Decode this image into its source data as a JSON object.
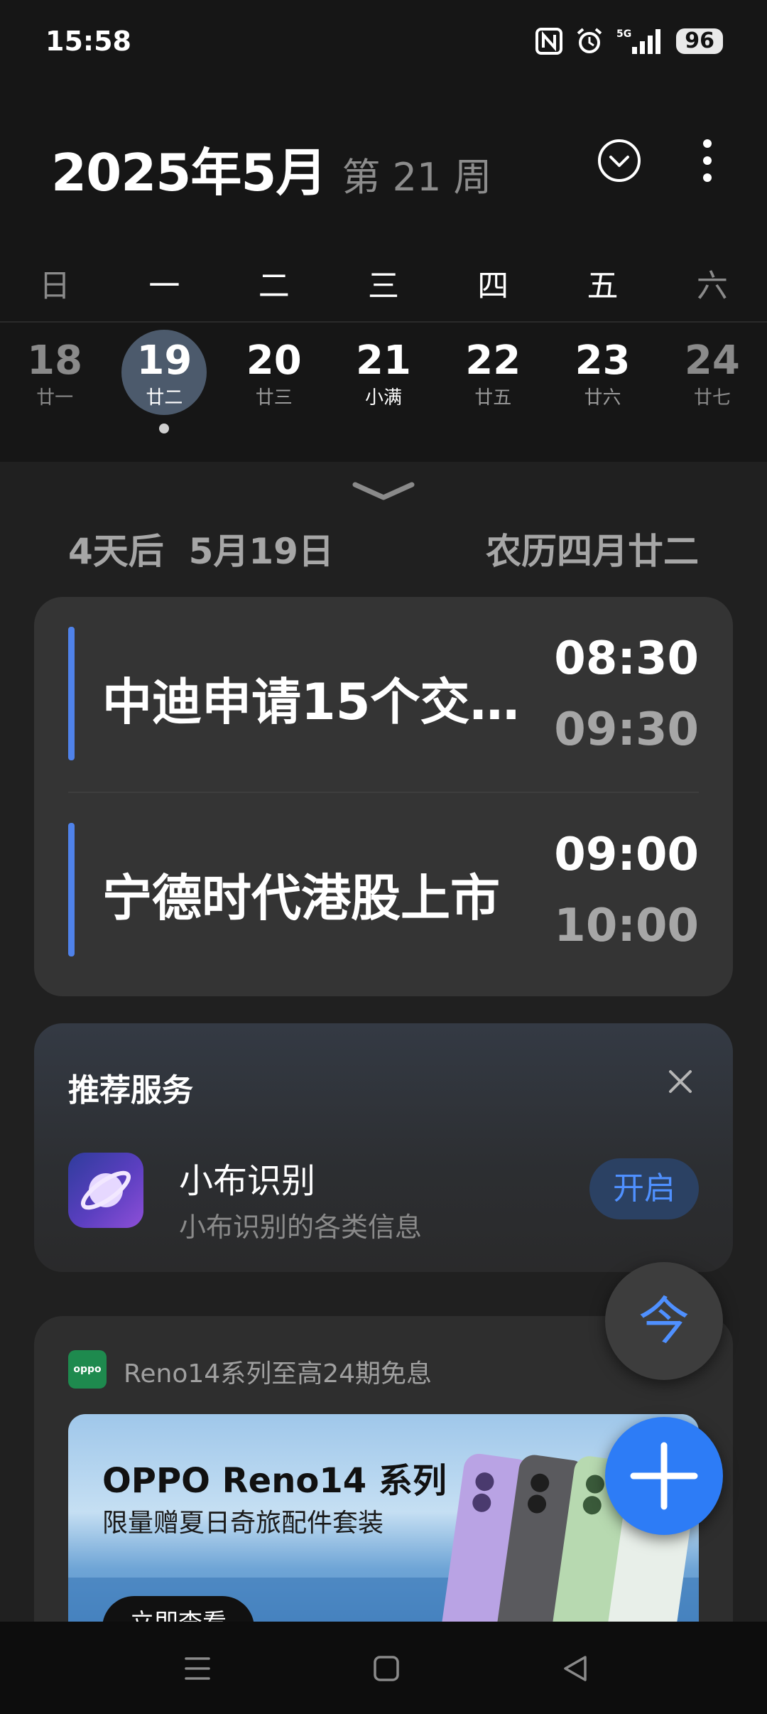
{
  "status_bar": {
    "time": "15:58",
    "network": "5G",
    "battery": "96",
    "icons": [
      "nfc-icon",
      "alarm-icon",
      "signal-icon",
      "battery-icon"
    ]
  },
  "header": {
    "month_title": "2025年5月",
    "week_label": "第 21 周",
    "buttons": [
      "dropdown-icon",
      "more-options-icon"
    ]
  },
  "week": {
    "weekdays": [
      "日",
      "一",
      "二",
      "三",
      "四",
      "五",
      "六"
    ],
    "days": [
      {
        "num": "18",
        "lunar": "廿一"
      },
      {
        "num": "19",
        "lunar": "廿二",
        "selected": true
      },
      {
        "num": "20",
        "lunar": "廿三"
      },
      {
        "num": "21",
        "lunar": "小满"
      },
      {
        "num": "22",
        "lunar": "廿五"
      },
      {
        "num": "23",
        "lunar": "廿六"
      },
      {
        "num": "24",
        "lunar": "廿七"
      }
    ]
  },
  "date_info": {
    "relative": "4天后  5月19日",
    "lunar_full": "农历四月廿二"
  },
  "events": [
    {
      "title": "中迪申请15个交…",
      "start": "08:30",
      "end": "09:30"
    },
    {
      "title": "宁德时代港股上市",
      "start": "09:00",
      "end": "10:00"
    }
  ],
  "recommend": {
    "title": "推荐服务",
    "app_name": "小布识别",
    "app_desc": "小布识别的各类信息",
    "enable_label": "开启"
  },
  "ad": {
    "logo_text": "oppo",
    "source": "Reno14系列至高24期免息",
    "headline": "OPPO Reno14 系列",
    "subline": "限量赠夏日奇旅配件套装",
    "cta": "立即查看"
  },
  "fab": {
    "today_label": "今"
  },
  "colors": {
    "accent": "#2d7cf6",
    "event_bar": "#4f82ea",
    "selected_day": "#4c5a6c"
  }
}
